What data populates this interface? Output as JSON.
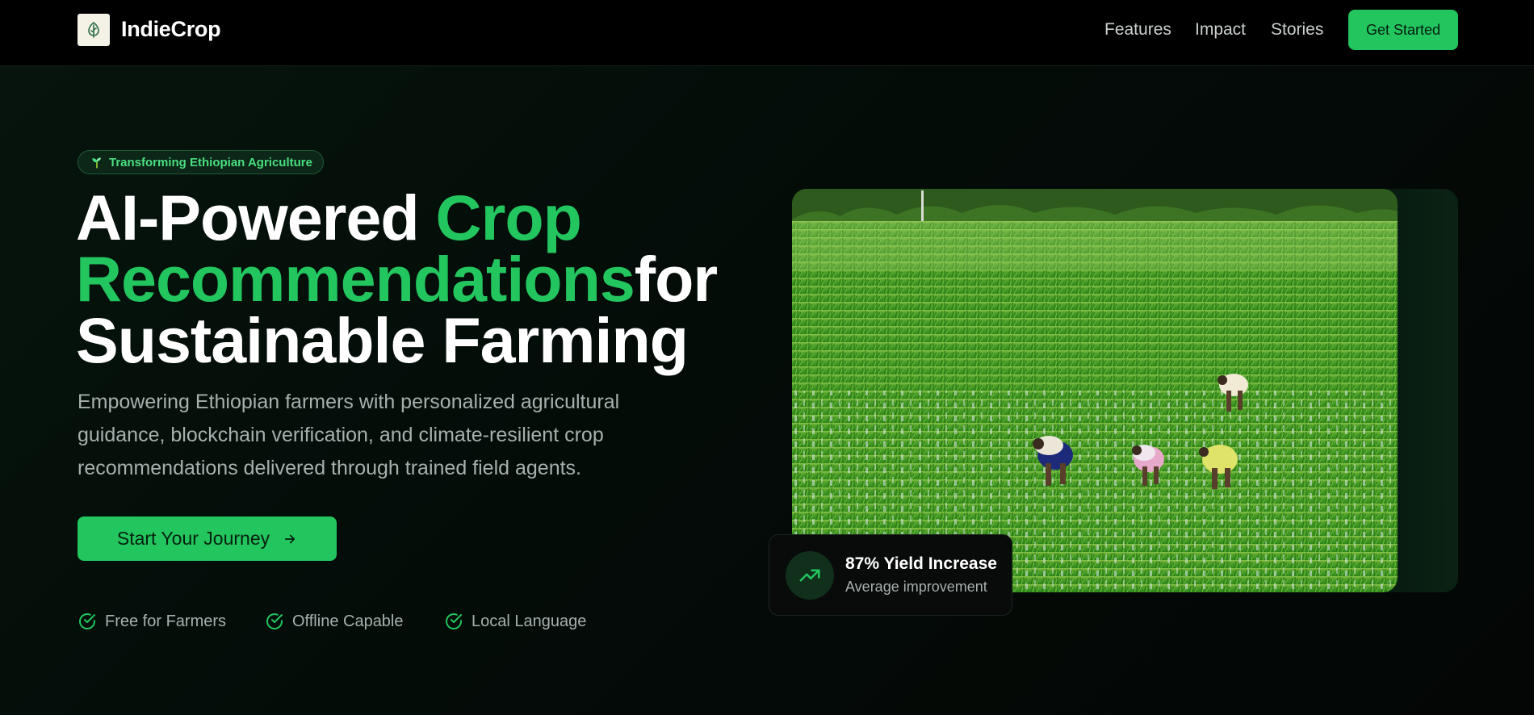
{
  "nav": {
    "brand": "IndieCrop",
    "links": [
      "Features",
      "Impact",
      "Stories"
    ],
    "cta": "Get Started"
  },
  "hero": {
    "badge": "Transforming Ethiopian Agriculture",
    "headline": {
      "part1": "AI-Powered ",
      "part2": "Crop Recommendations",
      "part3": "for Sustainable Farming"
    },
    "subtext": "Empowering Ethiopian farmers with personalized agricultural guidance, blockchain verification, and climate-resilient crop recommendations delivered through trained field agents.",
    "cta": "Start Your Journey",
    "features": [
      "Free for Farmers",
      "Offline Capable",
      "Local Language"
    ]
  },
  "stat": {
    "title": "87% Yield Increase",
    "subtitle": "Average improvement"
  },
  "icons": {
    "logo": "leaf-icon",
    "badge": "sprout-icon",
    "cta": "arrow-right-icon",
    "feature": "check-circle-icon",
    "stat": "trending-up-icon"
  },
  "colors": {
    "accent": "#22c55e",
    "background": "#040806",
    "muted_text": "#a7b0ad"
  }
}
